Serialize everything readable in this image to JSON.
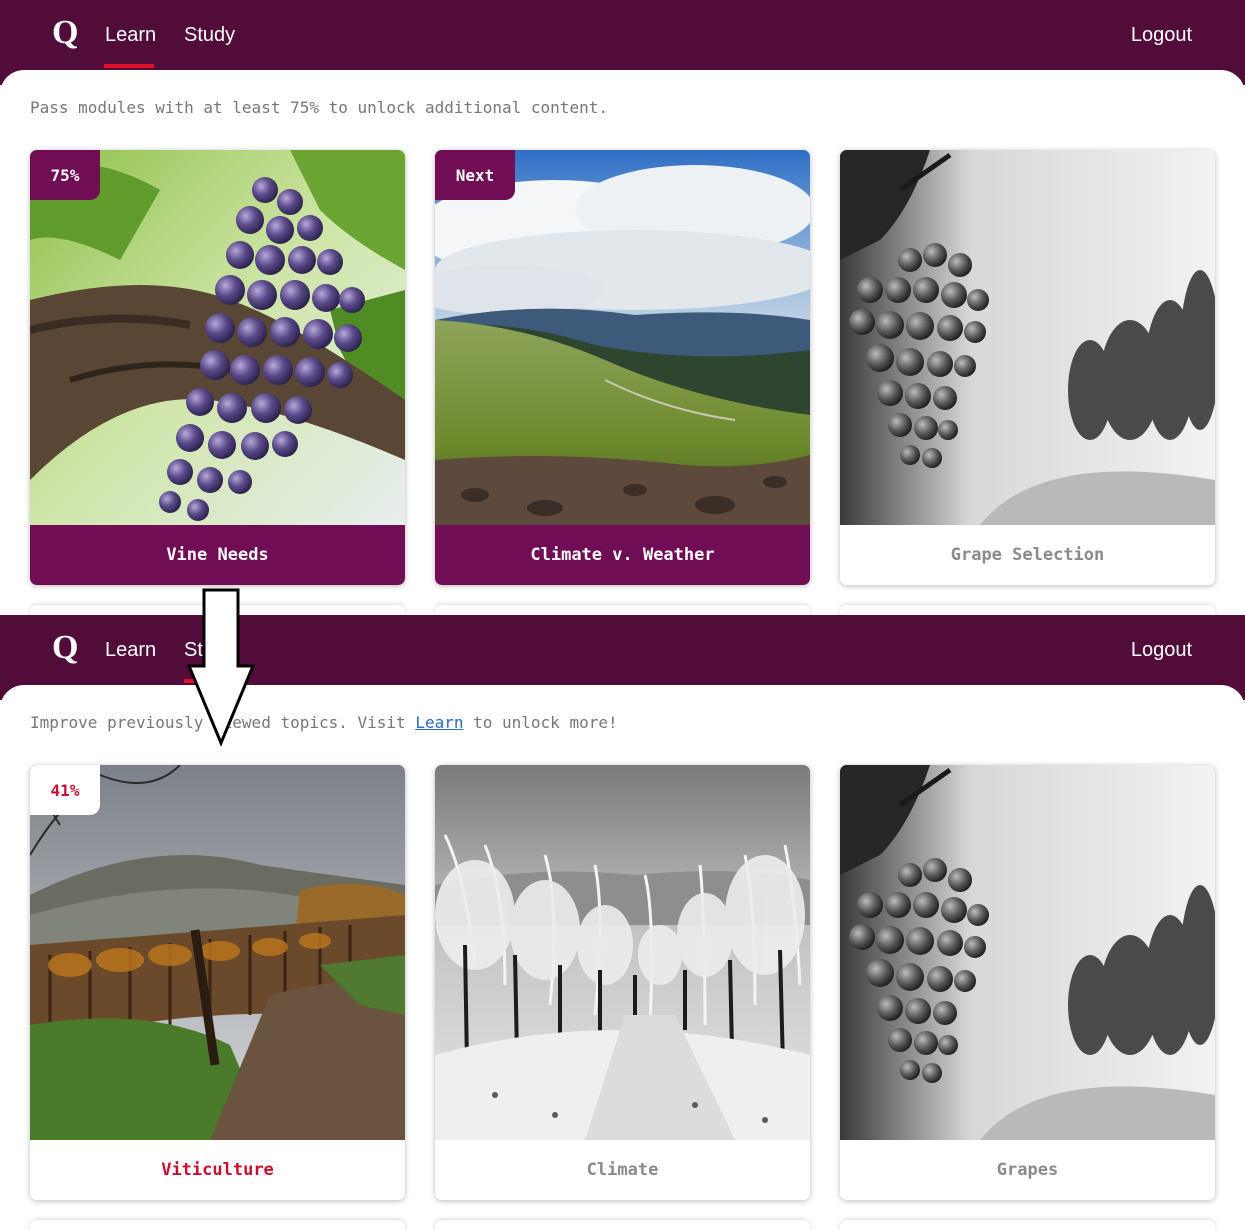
{
  "panels": [
    {
      "logo": "Q",
      "nav": {
        "learn": "Learn",
        "study": "Study",
        "active": "learn",
        "logout": "Logout"
      },
      "intro": "Pass modules with at least 75% to unlock additional content.",
      "cards": [
        {
          "title": "Vine Needs",
          "badge": "75%",
          "style": "purple",
          "image": "grape-cluster-photo"
        },
        {
          "title": "Climate v. Weather",
          "badge": "Next",
          "style": "purple",
          "image": "mountain-landscape-photo"
        },
        {
          "title": "Grape Selection",
          "badge": "",
          "style": "grey",
          "image": "grayscale-grape-photo"
        }
      ]
    },
    {
      "logo": "Q",
      "nav": {
        "learn": "Learn",
        "study": "Study",
        "active": "study",
        "logout": "Logout"
      },
      "intro_before": "Improve previously viewed topics. Visit ",
      "intro_link": "Learn",
      "intro_after": " to unlock more!",
      "cards": [
        {
          "title": "Viticulture",
          "badge": "41%",
          "style": "red",
          "image": "vineyard-autumn-photo"
        },
        {
          "title": "Climate",
          "badge": "",
          "style": "grey",
          "image": "frosted-vineyard-photo"
        },
        {
          "title": "Grapes",
          "badge": "",
          "style": "grey",
          "image": "grayscale-grape-photo"
        }
      ]
    }
  ],
  "annotation": {
    "icon": "down-arrow-icon"
  },
  "colors": {
    "nav_bg": "#520c3a",
    "accent_purple": "#710d55",
    "active_underline": "#e0102c",
    "badge_red": "#c8102e"
  }
}
